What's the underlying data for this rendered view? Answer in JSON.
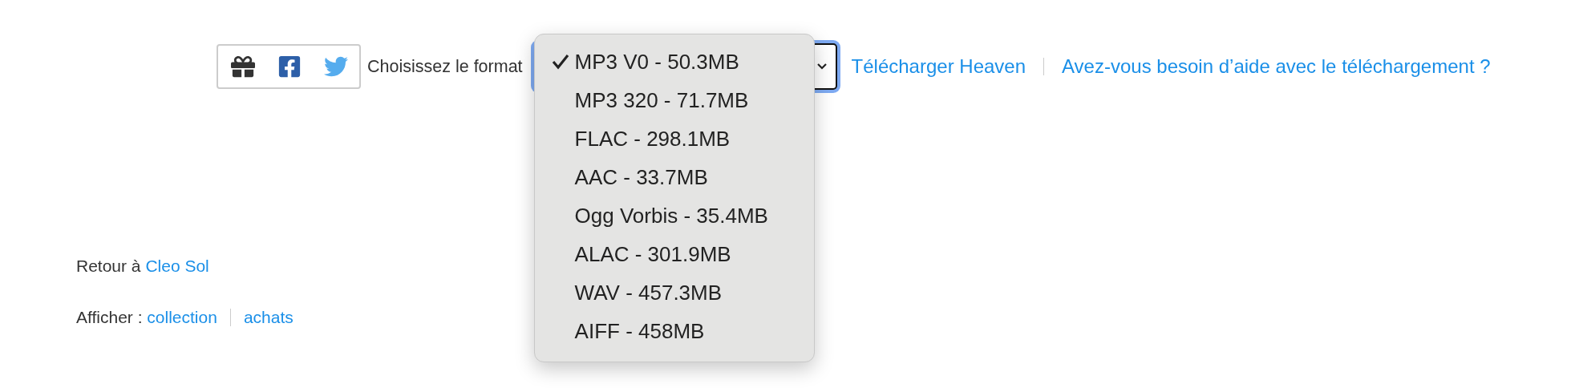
{
  "share": {
    "buttons": [
      {
        "kind": "gift"
      },
      {
        "kind": "facebook"
      },
      {
        "kind": "twitter"
      }
    ]
  },
  "format_picker": {
    "label": "Choisissez le format",
    "options": [
      {
        "label": "MP3 V0 - 50.3MB",
        "selected": true
      },
      {
        "label": "MP3 320 - 71.7MB",
        "selected": false
      },
      {
        "label": "FLAC - 298.1MB",
        "selected": false
      },
      {
        "label": "AAC - 33.7MB",
        "selected": false
      },
      {
        "label": "Ogg Vorbis - 35.4MB",
        "selected": false
      },
      {
        "label": "ALAC - 301.9MB",
        "selected": false
      },
      {
        "label": "WAV - 457.3MB",
        "selected": false
      },
      {
        "label": "AIFF - 458MB",
        "selected": false
      }
    ]
  },
  "links": [
    "Télécharger Heaven",
    "Avez-vous besoin d’aide avec le téléchargement ?"
  ],
  "back": {
    "text": "Retour à",
    "link": "Cleo Sol"
  },
  "view": {
    "label": "Afficher :",
    "links": [
      "collection",
      "achats"
    ]
  }
}
